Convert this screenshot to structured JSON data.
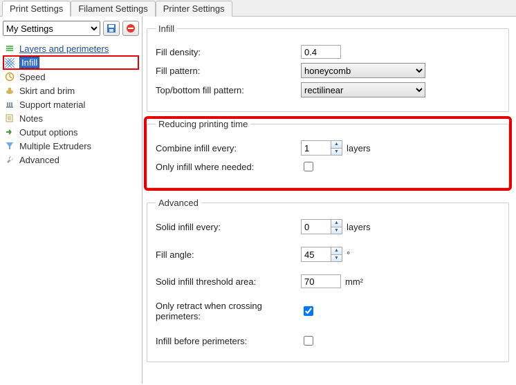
{
  "tabs": [
    "Print Settings",
    "Filament Settings",
    "Printer Settings"
  ],
  "activeTab": 0,
  "preset": {
    "selected": "My Settings"
  },
  "nav": {
    "items": [
      {
        "label": "Layers and perimeters",
        "icon": "layers"
      },
      {
        "label": "Infill",
        "icon": "infill",
        "selected": true
      },
      {
        "label": "Speed",
        "icon": "speed"
      },
      {
        "label": "Skirt and brim",
        "icon": "skirt"
      },
      {
        "label": "Support material",
        "icon": "support"
      },
      {
        "label": "Notes",
        "icon": "notes"
      },
      {
        "label": "Output options",
        "icon": "output"
      },
      {
        "label": "Multiple Extruders",
        "icon": "extruders"
      },
      {
        "label": "Advanced",
        "icon": "advanced"
      }
    ]
  },
  "group_infill": {
    "legend": "Infill",
    "fill_density": {
      "label": "Fill density:",
      "value": "0.4"
    },
    "fill_pattern": {
      "label": "Fill pattern:",
      "value": "honeycomb"
    },
    "top_bottom": {
      "label": "Top/bottom fill pattern:",
      "value": "rectilinear"
    }
  },
  "group_reduce": {
    "legend": "Reducing printing time",
    "combine": {
      "label": "Combine infill every:",
      "value": "1",
      "unit": "layers"
    },
    "only_where": {
      "label": "Only infill where needed:",
      "checked": false
    }
  },
  "group_adv": {
    "legend": "Advanced",
    "solid_every": {
      "label": "Solid infill every:",
      "value": "0",
      "unit": "layers"
    },
    "fill_angle": {
      "label": "Fill angle:",
      "value": "45",
      "unit": "°"
    },
    "threshold": {
      "label": "Solid infill threshold area:",
      "value": "70",
      "unit": "mm²"
    },
    "only_retract": {
      "label": "Only retract when crossing perimeters:",
      "checked": true
    },
    "before_perim": {
      "label": "Infill before perimeters:",
      "checked": false
    }
  }
}
